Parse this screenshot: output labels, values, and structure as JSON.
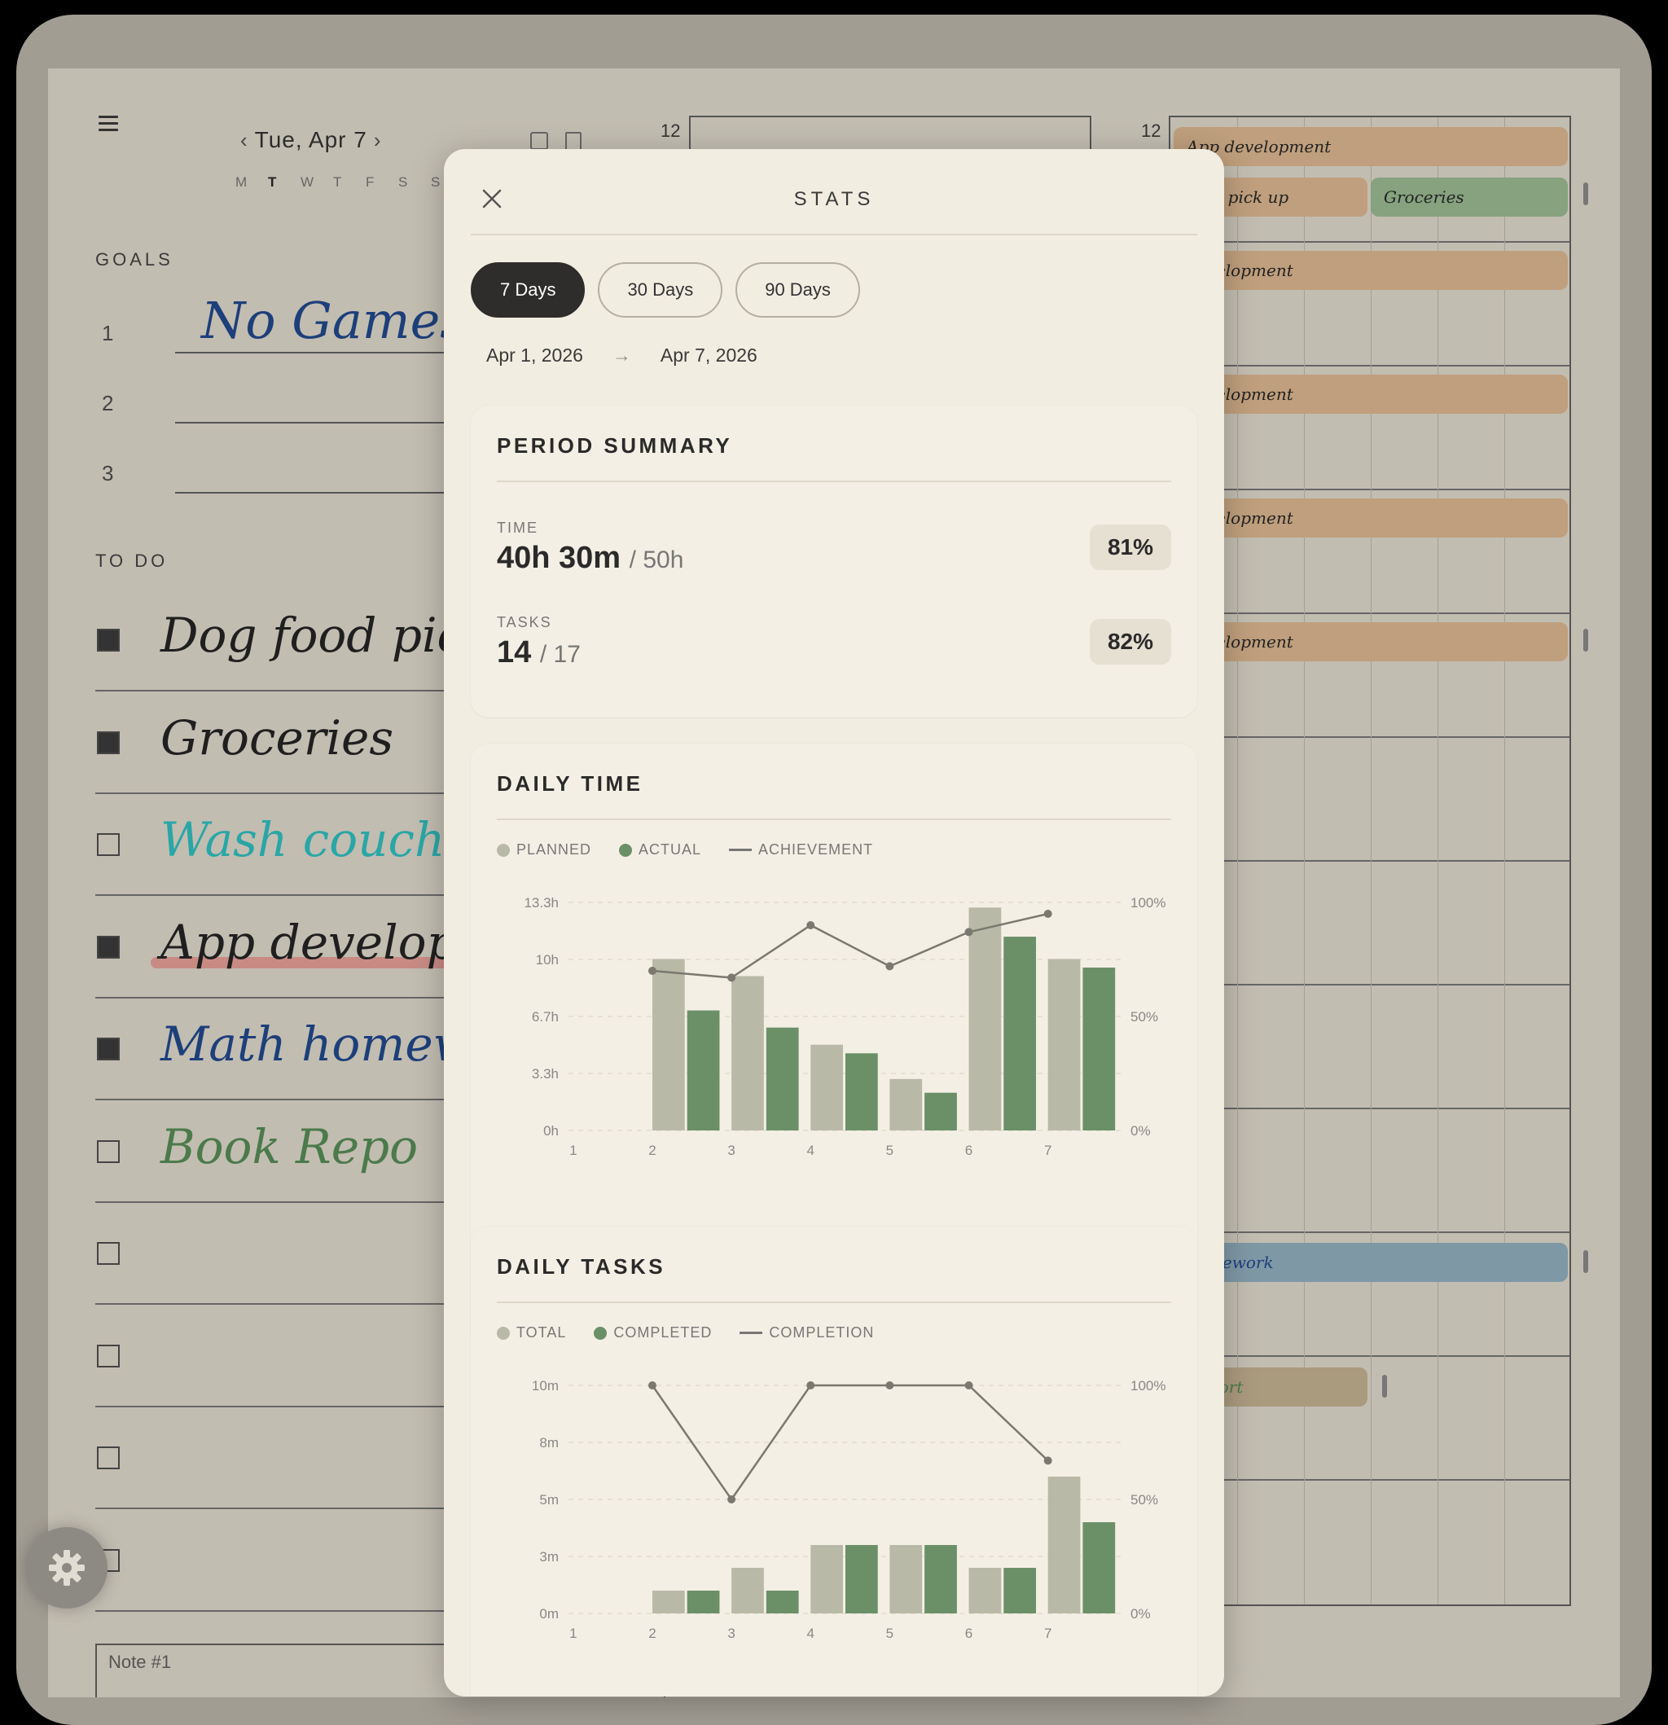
{
  "planner": {
    "date": "Tue, Apr 7",
    "weekdays": [
      "M",
      "T",
      "W",
      "T",
      "F",
      "S",
      "S"
    ],
    "goals_label": "GOALS",
    "goals": [
      {
        "num": "1",
        "text": "No Games!"
      },
      {
        "num": "2",
        "text": ""
      },
      {
        "num": "3",
        "text": ""
      }
    ],
    "todo_label": "TO DO",
    "todos": [
      {
        "text": "Dog food pic",
        "done": true,
        "color": "#1f1f1f"
      },
      {
        "text": "Groceries",
        "done": true,
        "color": "#1f1f1f"
      },
      {
        "text": "Wash couch",
        "done": false,
        "color": "#2aa6a6"
      },
      {
        "text": "App developm",
        "done": true,
        "color": "#1f1f1f"
      },
      {
        "text": "Math homew",
        "done": true,
        "color": "#1d3f7a"
      },
      {
        "text": "Book Repo",
        "done": false,
        "color": "#4b7a4b"
      },
      {
        "text": "",
        "done": false
      },
      {
        "text": "",
        "done": false
      },
      {
        "text": "",
        "done": false
      },
      {
        "text": "",
        "done": false
      }
    ],
    "hour_left": "12",
    "hour_right": "12",
    "events": [
      {
        "label": "App development"
      },
      {
        "label": "food pick up"
      },
      {
        "label": "Groceries"
      },
      {
        "label": "development"
      },
      {
        "label": "development"
      },
      {
        "label": "development"
      },
      {
        "label": "development"
      },
      {
        "label": "homework"
      },
      {
        "label": "Report"
      }
    ],
    "note_label": "Note #1"
  },
  "stats": {
    "title": "STATS",
    "tabs": [
      "7 Days",
      "30 Days",
      "90 Days"
    ],
    "active_tab": "7 Days",
    "range_start": "Apr 1, 2026",
    "range_end": "Apr 7, 2026",
    "range_arrow": "→",
    "summary": {
      "title": "PERIOD SUMMARY",
      "time_label": "TIME",
      "time_value": "40h 30m",
      "time_of": "/ 50h",
      "time_pct": "81%",
      "tasks_label": "TASKS",
      "tasks_value": "14",
      "tasks_of": "/ 17",
      "tasks_pct": "82%"
    },
    "daily_time": {
      "title": "DAILY TIME",
      "legend": [
        "PLANNED",
        "ACTUAL",
        "ACHIEVEMENT"
      ]
    },
    "daily_tasks": {
      "title": "DAILY TASKS",
      "legend": [
        "TOTAL",
        "COMPLETED",
        "COMPLETION"
      ]
    }
  },
  "colors": {
    "planned": "#b9b9a8",
    "actual": "#6b9068",
    "line": "#7a786f"
  },
  "chart_data": [
    {
      "type": "bar",
      "title": "DAILY TIME",
      "categories": [
        "1",
        "2",
        "3",
        "4",
        "5",
        "6",
        "7"
      ],
      "y_ticks": [
        "0h",
        "3.3h",
        "6.7h",
        "10h",
        "13.3h"
      ],
      "y2_ticks": [
        "0%",
        "50%",
        "100%"
      ],
      "ylim": [
        0,
        13.3
      ],
      "y2lim": [
        0,
        100
      ],
      "series": [
        {
          "name": "PLANNED",
          "kind": "bar",
          "values": [
            0,
            10.0,
            9.0,
            5.0,
            3.0,
            13.0,
            10.0
          ]
        },
        {
          "name": "ACTUAL",
          "kind": "bar",
          "values": [
            0,
            7.0,
            6.0,
            4.5,
            2.2,
            11.3,
            9.5
          ]
        },
        {
          "name": "ACHIEVEMENT",
          "kind": "line",
          "axis": "y2",
          "values": [
            null,
            70,
            67,
            90,
            72,
            87,
            95
          ]
        }
      ]
    },
    {
      "type": "bar",
      "title": "DAILY TASKS",
      "categories": [
        "1",
        "2",
        "3",
        "4",
        "5",
        "6",
        "7"
      ],
      "y_ticks": [
        "0m",
        "3m",
        "5m",
        "8m",
        "10m"
      ],
      "y2_ticks": [
        "0%",
        "50%",
        "100%"
      ],
      "ylim": [
        0,
        10
      ],
      "y2lim": [
        0,
        100
      ],
      "series": [
        {
          "name": "TOTAL",
          "kind": "bar",
          "values": [
            0,
            1,
            2,
            3,
            3,
            2,
            6
          ]
        },
        {
          "name": "COMPLETED",
          "kind": "bar",
          "values": [
            0,
            1,
            1,
            3,
            3,
            2,
            4
          ]
        },
        {
          "name": "COMPLETION",
          "kind": "line",
          "axis": "y2",
          "values": [
            null,
            100,
            50,
            100,
            100,
            100,
            67
          ]
        }
      ]
    }
  ]
}
